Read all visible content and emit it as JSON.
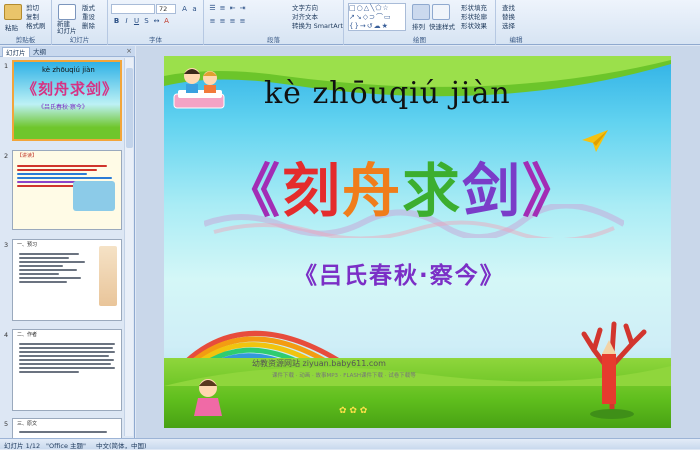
{
  "ribbon": {
    "clipboard": {
      "paste": "粘贴",
      "cut": "剪切",
      "copy": "复制",
      "format_painter": "格式刷",
      "label": "剪贴板"
    },
    "slides": {
      "new_slide": "新建\n幻灯片",
      "layout": "版式",
      "reset": "重设",
      "delete": "删除",
      "label": "幻灯片"
    },
    "font": {
      "size": "72",
      "label": "字体"
    },
    "paragraph": {
      "text_direction": "文字方向",
      "align_text": "对齐文本",
      "convert_smartart": "转换为 SmartArt",
      "label": "段落"
    },
    "drawing": {
      "arrange": "排列",
      "quick_styles": "快速样式",
      "shape_fill": "形状填充",
      "shape_outline": "形状轮廓",
      "shape_effects": "形状效果",
      "label": "绘图"
    },
    "editing": {
      "find": "查找",
      "replace": "替换",
      "select": "选择",
      "label": "编辑"
    }
  },
  "left_pane": {
    "tabs": [
      "幻灯片",
      "大纲"
    ],
    "close": "×",
    "thumbnails": [
      {
        "number": "1",
        "lines": []
      },
      {
        "number": "2",
        "lines": [
          "【讲读】"
        ]
      },
      {
        "number": "3",
        "lines": [
          "一、预习"
        ]
      },
      {
        "number": "4",
        "lines": [
          "二、作者"
        ]
      },
      {
        "number": "5",
        "lines": [
          "三、原文"
        ]
      }
    ]
  },
  "slide": {
    "pinyin": "kè zhōuqiú jiàn",
    "title_open": "《",
    "title_chars": [
      "刻",
      "舟",
      "求",
      "剑"
    ],
    "title_close": "》",
    "subtitle": "《吕氏春秋·察今》",
    "watermark": "幼教资源网站  ziyuan.baby611.com",
    "watermark_sub": "课件下载 · 动画 · 故事MP3 · FLASH课件下载 · 试卷下载等"
  },
  "status": {
    "slide_info": "幻灯片 1/12",
    "theme": "\"Office 主题\"",
    "language": "中文(简体，中国)"
  },
  "colors": {
    "accent": "#15428b",
    "title_red": "#e42c2c",
    "subtitle": "#7b2fc6",
    "selection": "#f2a53a"
  }
}
